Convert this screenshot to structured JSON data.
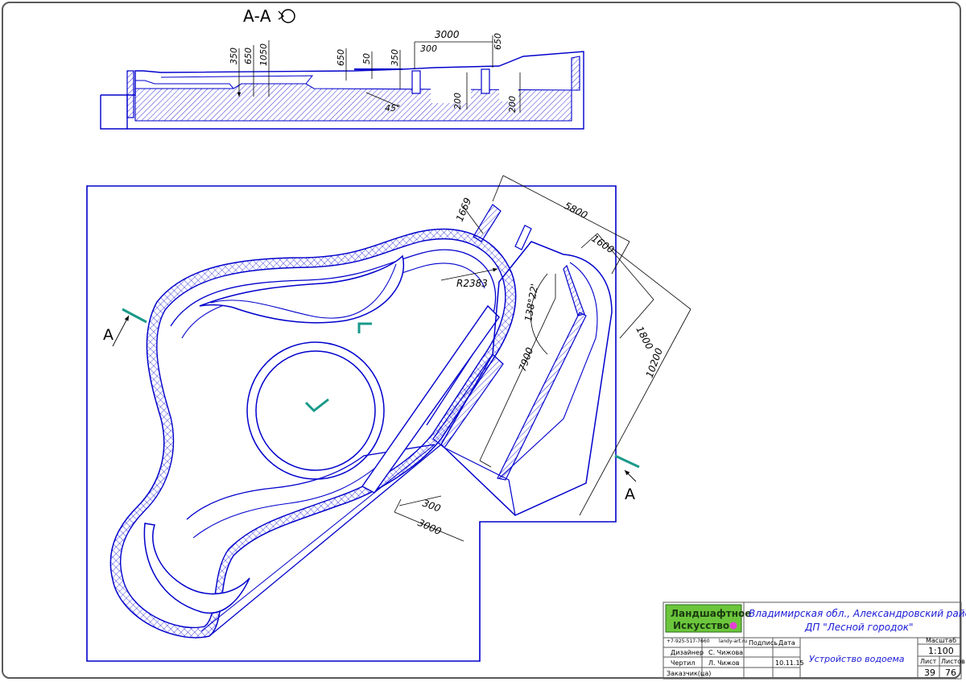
{
  "section": {
    "title": "А-А",
    "dims": [
      "350",
      "650",
      "1050",
      "650",
      "50",
      "350",
      "300",
      "3000",
      "650",
      "200",
      "200",
      "45°"
    ]
  },
  "plan": {
    "cut_label_left": "А",
    "cut_label_right": "А",
    "dims": [
      "1669",
      "5800",
      "1600",
      "R2383",
      "138°22'",
      "1800",
      "7900",
      "10200",
      "300",
      "3000"
    ]
  },
  "title_block": {
    "logo_line1": "Ландшафтное",
    "logo_line2": "Искусство",
    "address_line1": "Владимирская обл., Александровский район,",
    "address_line2": "ДП \"Лесной городок\"",
    "phone": "+7-925-517-7660",
    "site": "landy-art.ru",
    "col_sign": "Подпись",
    "col_date": "Дата",
    "row1_role": "Дизайнер",
    "row1_name": "С. Чижова",
    "row2_role": "Чертил",
    "row2_name": "Л. Чижов",
    "row2_date": "10.11.15",
    "row3_role": "Заказчик(ца)",
    "drawing_title": "Устройство водоема",
    "scale_label": "Масштаб",
    "scale_value": "1:100",
    "sheet_label": "Лист",
    "sheets_label": "Листов",
    "sheet_value": "39",
    "sheets_value": "76"
  },
  "colors": {
    "line": "#0000cc",
    "accent": "#1a9a8a",
    "frame": "#5a5a5a",
    "logo_green": "#6cc63c",
    "logo_dot": "#e63fd6"
  }
}
